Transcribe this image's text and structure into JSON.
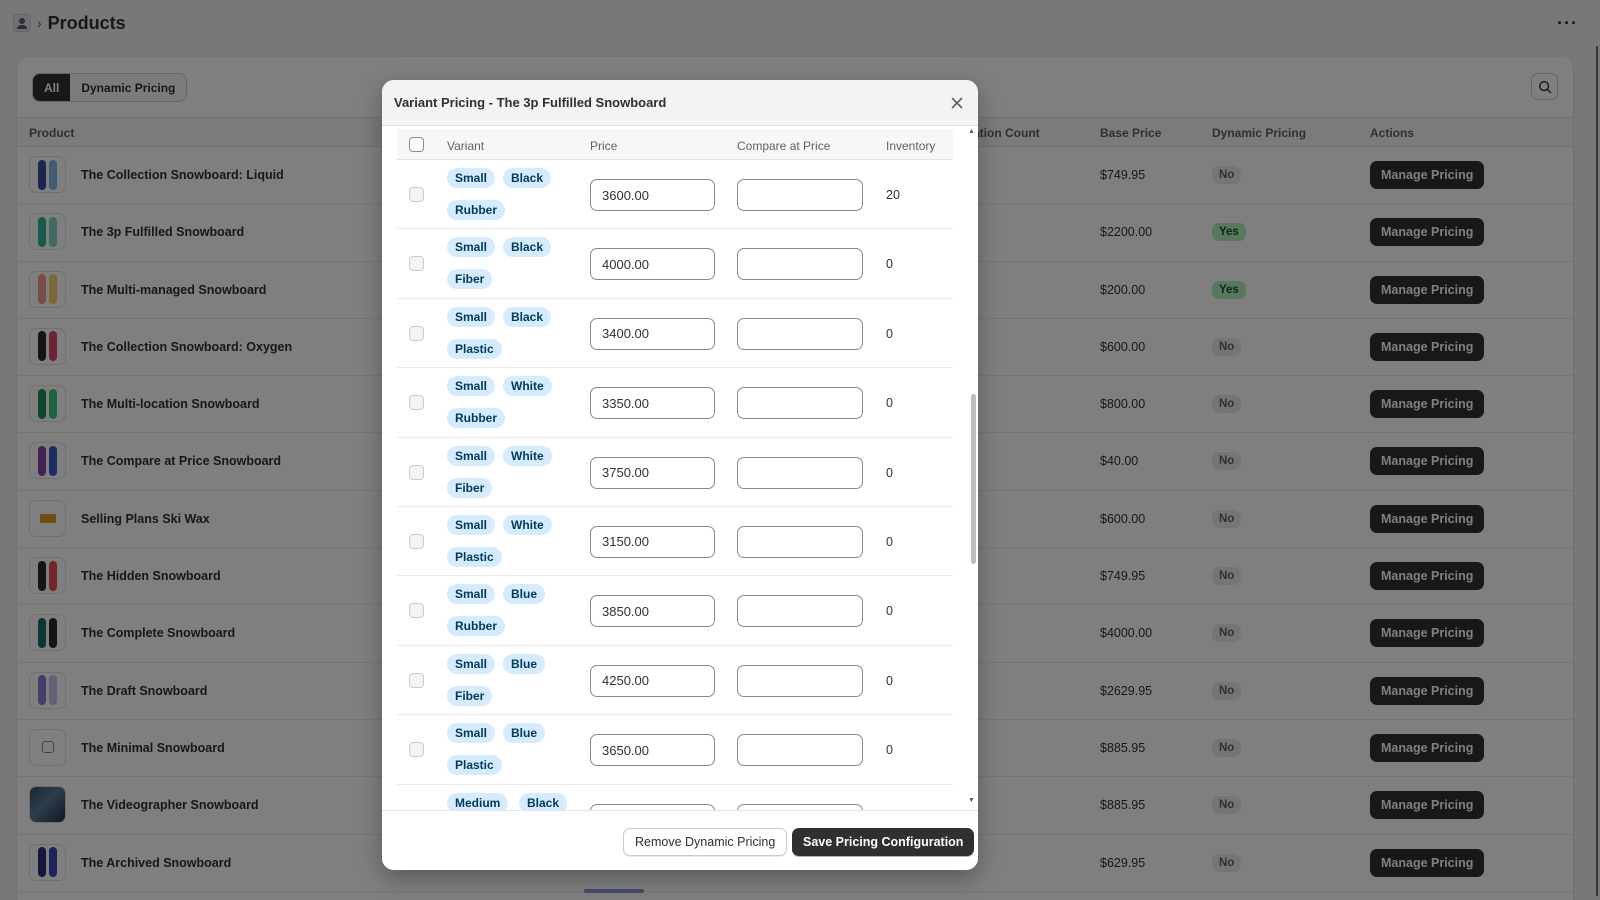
{
  "breadcrumb": {
    "title": "Products"
  },
  "filters": [
    {
      "label": "All",
      "active": true
    },
    {
      "label": "Dynamic Pricing",
      "active": false
    }
  ],
  "columns": {
    "product": "Product",
    "count": "ation Count",
    "base_price": "Base Price",
    "dynamic": "Dynamic Pricing",
    "actions": "Actions"
  },
  "products": [
    {
      "name": "The Collection Snowboard: Liquid",
      "price": "$749.95",
      "dynamic": "No",
      "action": "Manage Pricing",
      "thumb": "board",
      "colors": [
        "#3b4f9c",
        "#7fb8e8"
      ]
    },
    {
      "name": "The 3p Fulfilled Snowboard",
      "price": "$2200.00",
      "dynamic": "Yes",
      "action": "Manage Pricing",
      "thumb": "board",
      "colors": [
        "#2fb5a0",
        "#7fd6c6"
      ]
    },
    {
      "name": "The Multi-managed Snowboard",
      "price": "$200.00",
      "dynamic": "Yes",
      "action": "Manage Pricing",
      "thumb": "board",
      "colors": [
        "#f29a8f",
        "#f7d36b"
      ]
    },
    {
      "name": "The Collection Snowboard: Oxygen",
      "price": "$600.00",
      "dynamic": "No",
      "action": "Manage Pricing",
      "thumb": "board",
      "colors": [
        "#2b2b2b",
        "#d74a6b"
      ]
    },
    {
      "name": "The Multi-location Snowboard",
      "price": "$800.00",
      "dynamic": "No",
      "action": "Manage Pricing",
      "thumb": "board",
      "colors": [
        "#1e8f5a",
        "#3ac27c"
      ]
    },
    {
      "name": "The Compare at Price Snowboard",
      "price": "$40.00",
      "dynamic": "No",
      "action": "Manage Pricing",
      "thumb": "board",
      "colors": [
        "#8c3fa8",
        "#3a56c9"
      ]
    },
    {
      "name": "Selling Plans Ski Wax",
      "price": "$600.00",
      "dynamic": "No",
      "action": "Manage Pricing",
      "thumb": "wax",
      "colors": []
    },
    {
      "name": "The Hidden Snowboard",
      "price": "$749.95",
      "dynamic": "No",
      "action": "Manage Pricing",
      "thumb": "board",
      "colors": [
        "#2b2b2b",
        "#e84d4d"
      ]
    },
    {
      "name": "The Complete Snowboard",
      "price": "$4000.00",
      "dynamic": "No",
      "action": "Manage Pricing",
      "thumb": "board",
      "colors": [
        "#1d6b6b",
        "#2b2b2b"
      ]
    },
    {
      "name": "The Draft Snowboard",
      "price": "$2629.95",
      "dynamic": "No",
      "action": "Manage Pricing",
      "thumb": "board",
      "colors": [
        "#8d7bd6",
        "#c8c0ef"
      ]
    },
    {
      "name": "The Minimal Snowboard",
      "price": "$885.95",
      "dynamic": "No",
      "action": "Manage Pricing",
      "thumb": "minimal",
      "colors": []
    },
    {
      "name": "The Videographer Snowboard",
      "price": "$885.95",
      "dynamic": "No",
      "action": "Manage Pricing",
      "thumb": "video",
      "colors": []
    },
    {
      "name": "The Archived Snowboard",
      "price": "$629.95",
      "dynamic": "No",
      "action": "Manage Pricing",
      "thumb": "board",
      "colors": [
        "#2a2f7a",
        "#3a48b8"
      ]
    }
  ],
  "modal": {
    "title": "Variant Pricing - The 3p Fulfilled Snowboard",
    "columns": {
      "variant": "Variant",
      "price": "Price",
      "compare": "Compare at Price",
      "inventory": "Inventory"
    },
    "variants": [
      {
        "options": [
          "Small",
          "Black",
          "Rubber"
        ],
        "price": "3600.00",
        "compare": "",
        "inventory": "20"
      },
      {
        "options": [
          "Small",
          "Black",
          "Fiber"
        ],
        "price": "4000.00",
        "compare": "",
        "inventory": "0"
      },
      {
        "options": [
          "Small",
          "Black",
          "Plastic"
        ],
        "price": "3400.00",
        "compare": "",
        "inventory": "0"
      },
      {
        "options": [
          "Small",
          "White",
          "Rubber"
        ],
        "price": "3350.00",
        "compare": "",
        "inventory": "0"
      },
      {
        "options": [
          "Small",
          "White",
          "Fiber"
        ],
        "price": "3750.00",
        "compare": "",
        "inventory": "0"
      },
      {
        "options": [
          "Small",
          "White",
          "Plastic"
        ],
        "price": "3150.00",
        "compare": "",
        "inventory": "0"
      },
      {
        "options": [
          "Small",
          "Blue",
          "Rubber"
        ],
        "price": "3850.00",
        "compare": "",
        "inventory": "0"
      },
      {
        "options": [
          "Small",
          "Blue",
          "Fiber"
        ],
        "price": "4250.00",
        "compare": "",
        "inventory": "0"
      },
      {
        "options": [
          "Small",
          "Blue",
          "Plastic"
        ],
        "price": "3650.00",
        "compare": "",
        "inventory": "0"
      },
      {
        "options": [
          "Medium",
          "Black",
          ""
        ],
        "price": "",
        "compare": "",
        "inventory": ""
      }
    ],
    "remove_label": "Remove Dynamic Pricing",
    "save_label": "Save Pricing Configuration"
  },
  "colors": {
    "primary": "#303030",
    "tag_bg": "#d5ebff",
    "yes_bg": "#aff0b5",
    "no_bg": "#ebebeb"
  }
}
